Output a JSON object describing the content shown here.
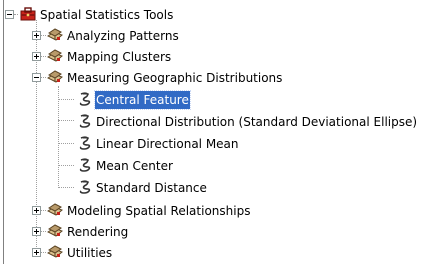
{
  "tree": {
    "root": {
      "label": "Spatial Statistics Tools",
      "icon": "toolbox-icon",
      "expanded": true
    },
    "toolsets": [
      {
        "label": "Analyzing Patterns",
        "icon": "toolset-icon",
        "expanded": false
      },
      {
        "label": "Mapping Clusters",
        "icon": "toolset-icon",
        "expanded": false
      },
      {
        "label": "Measuring Geographic Distributions",
        "icon": "toolset-icon",
        "expanded": true,
        "tools": [
          {
            "label": "Central Feature",
            "icon": "script-tool-icon",
            "selected": true
          },
          {
            "label": "Directional Distribution (Standard Deviational Ellipse)",
            "icon": "script-tool-icon",
            "selected": false
          },
          {
            "label": "Linear Directional Mean",
            "icon": "script-tool-icon",
            "selected": false
          },
          {
            "label": "Mean Center",
            "icon": "script-tool-icon",
            "selected": false
          },
          {
            "label": "Standard Distance",
            "icon": "script-tool-icon",
            "selected": false
          }
        ]
      },
      {
        "label": "Modeling Spatial Relationships",
        "icon": "toolset-icon",
        "expanded": false
      },
      {
        "label": "Rendering",
        "icon": "toolset-icon",
        "expanded": false
      },
      {
        "label": "Utilities",
        "icon": "toolset-icon",
        "expanded": false
      }
    ]
  },
  "colors": {
    "selection": "#316ac5",
    "toolbox_red": "#c8221a",
    "toolset_tan": "#b89a6a"
  }
}
